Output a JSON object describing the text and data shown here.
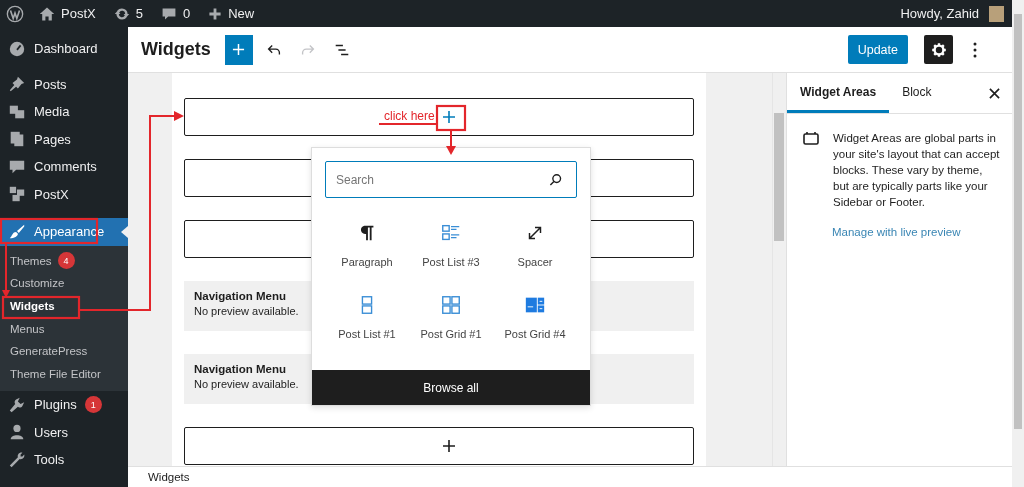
{
  "admin_bar": {
    "items": [
      {
        "kind": "home",
        "label": "PostX"
      },
      {
        "kind": "updates",
        "label": "5"
      },
      {
        "kind": "comments",
        "label": "0"
      },
      {
        "kind": "new",
        "label": "New"
      }
    ],
    "greeting": "Howdy, Zahid"
  },
  "sidebar": {
    "items": [
      {
        "kind": "dashboard",
        "label": "Dashboard",
        "selected": false
      },
      {
        "kind": "posts",
        "label": "Posts",
        "selected": false
      },
      {
        "kind": "media",
        "label": "Media",
        "selected": false
      },
      {
        "kind": "pages",
        "label": "Pages",
        "selected": false
      },
      {
        "kind": "comments",
        "label": "Comments",
        "selected": false
      },
      {
        "kind": "postx",
        "label": "PostX",
        "selected": false
      },
      {
        "kind": "appearance",
        "label": "Appearance",
        "selected": true,
        "children": [
          {
            "label": "Themes",
            "badge": "4",
            "selected": false
          },
          {
            "label": "Customize",
            "selected": false
          },
          {
            "label": "Widgets",
            "selected": true
          },
          {
            "label": "Menus",
            "selected": false
          },
          {
            "label": "GeneratePress",
            "selected": false
          },
          {
            "label": "Theme File Editor",
            "selected": false
          }
        ]
      },
      {
        "kind": "plugins",
        "label": "Plugins",
        "badge": "1",
        "selected": false
      },
      {
        "kind": "users",
        "label": "Users",
        "selected": false
      },
      {
        "kind": "tools",
        "label": "Tools",
        "selected": false
      }
    ]
  },
  "header": {
    "title": "Widgets",
    "undo": {
      "disabled": false
    },
    "redo": {
      "disabled": true
    },
    "update_button": "Update"
  },
  "canvas": {
    "blocks": [
      {
        "kind": "appender",
        "active": true
      },
      {
        "kind": "empty"
      },
      {
        "kind": "empty"
      },
      {
        "kind": "preview",
        "title": "Navigation Menu",
        "message": "No preview available."
      },
      {
        "kind": "preview",
        "title": "Navigation Menu",
        "message": "No preview available."
      },
      {
        "kind": "appender",
        "active": false
      }
    ]
  },
  "inserter": {
    "search": {
      "placeholder": "Search"
    },
    "blocks": [
      {
        "kind": "paragraph",
        "label": "Paragraph"
      },
      {
        "kind": "post-list-3",
        "label": "Post List #3"
      },
      {
        "kind": "spacer",
        "label": "Spacer"
      },
      {
        "kind": "post-list-1",
        "label": "Post List #1"
      },
      {
        "kind": "post-grid-1",
        "label": "Post Grid #1"
      },
      {
        "kind": "post-grid-4",
        "label": "Post Grid #4"
      }
    ],
    "browse_all": "Browse all"
  },
  "annotation": {
    "text": "click here"
  },
  "settings_panel": {
    "tabs": [
      {
        "label": "Widget Areas",
        "selected": true
      },
      {
        "label": "Block",
        "selected": false
      }
    ],
    "description": "Widget Areas are global parts in your site's layout that can accept blocks. These vary by theme, but are typically parts like your Sidebar or Footer.",
    "link": "Manage with live preview"
  },
  "footer": {
    "breadcrumb": "Widgets"
  }
}
